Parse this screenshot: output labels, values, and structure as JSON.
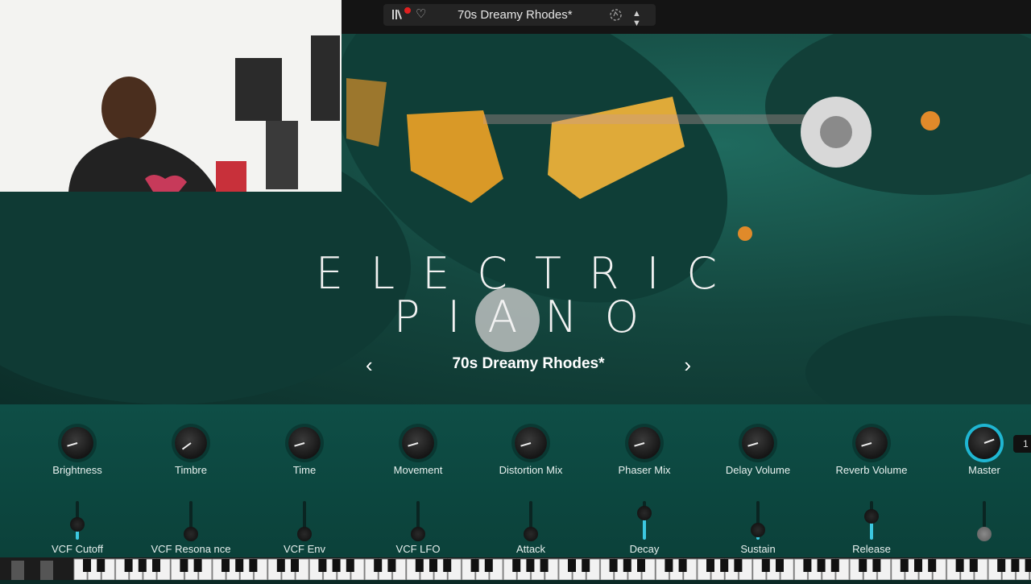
{
  "header": {
    "preset_name": "70s Dreamy Rhodes*",
    "library_icon": "library-icon",
    "favorite_icon": "heart-icon",
    "sync_icon": "sync-icon",
    "arrows": "▲ ▼"
  },
  "hero": {
    "title_line1": "ELECTRIC",
    "title_line2": "PIANO",
    "preset_name": "70s Dreamy Rhodes*",
    "prev": "‹",
    "next": "›"
  },
  "knobs": [
    {
      "label": "Brightness",
      "value": 0.12
    },
    {
      "label": "Timbre",
      "value": 0.05
    },
    {
      "label": "Time",
      "value": 0.12
    },
    {
      "label": "Movement",
      "value": 0.12
    },
    {
      "label": "Distortion Mix",
      "value": 0.12
    },
    {
      "label": "Phaser Mix",
      "value": 0.12
    },
    {
      "label": "Delay Volume",
      "value": 0.12
    },
    {
      "label": "Reverb Volume",
      "value": 0.12
    },
    {
      "label": "Master",
      "value": 0.75
    }
  ],
  "sliders": [
    {
      "label": "VCF Cutoff",
      "value": 0.25
    },
    {
      "label": "VCF Resona nce",
      "value": 0.0
    },
    {
      "label": "VCF Env",
      "value": 0.0
    },
    {
      "label": "VCF LFO",
      "value": 0.0
    },
    {
      "label": "Attack",
      "value": 0.0
    },
    {
      "label": "Decay",
      "value": 0.55
    },
    {
      "label": "Sustain",
      "value": 0.1
    },
    {
      "label": "Release",
      "value": 0.45
    },
    {
      "label": "",
      "value": 0.0
    }
  ],
  "badge": "1",
  "colors": {
    "accent": "#3cc8e0",
    "panel": "#0e4e46",
    "background": "#14473f"
  }
}
